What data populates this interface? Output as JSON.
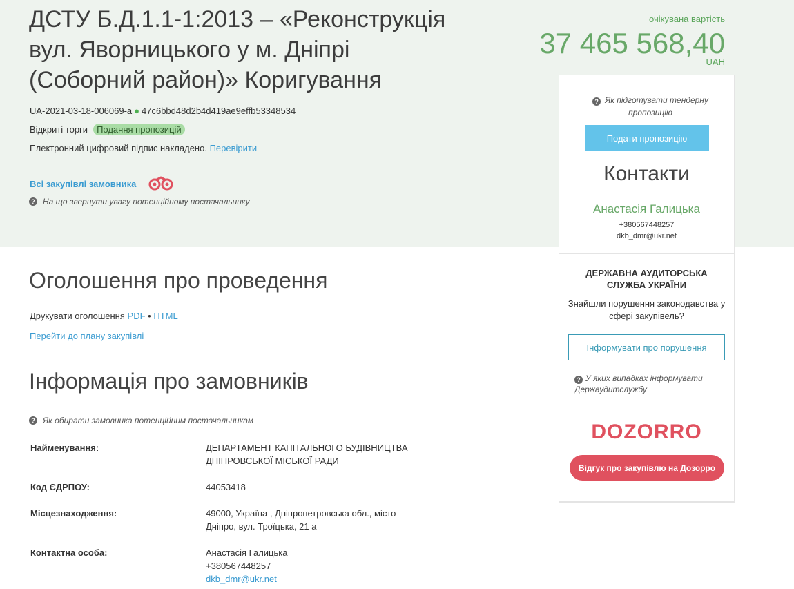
{
  "header": {
    "title": "ДСТУ Б.Д.1.1-1:2013 – «Реконструкція вул. Яворницького у м. Дніпрі (Соборний район)» Коригування",
    "tender_id": "UA-2021-03-18-006069-a",
    "tender_hash": "47c6bbd48d2b4d419ae9effb53348534",
    "procedure_type": "Відкриті торги",
    "status_badge": "Подання пропозицій",
    "signature_text": "Електронний цифровий підпис накладено.",
    "signature_link": "Перевірити",
    "all_purchases_link": "Всі закупівлі замовника",
    "supplier_hint": "На що звернути увагу потенційному постачальнику"
  },
  "expected_value": {
    "label": "очікувана вартість",
    "amount": "37 465 568,40",
    "currency": "UAH"
  },
  "sidebar": {
    "prepare_hint": "Як підготувати тендерну пропозицію",
    "propose_button": "Подати пропозицію",
    "contacts_title": "Контакти",
    "contact_name": "Анастасія Галицька",
    "contact_phone": "+380567448257",
    "contact_email": "dkb_dmr@ukr.net",
    "dasu_title": "ДЕРЖАВНА АУДИТОРСЬКА СЛУЖБА УКРАЇНИ",
    "dasu_text": "Знайшли порушення законодавства у сфері закупівель?",
    "inform_button": "Інформувати про порушення",
    "dasu_hint": "У яких випадках інформувати Держаудитслужбу",
    "dozorro_logo": "DOZORRO",
    "dozorro_button": "Відгук про закупівлю на Дозорро"
  },
  "announcement": {
    "heading": "Оголошення про проведення",
    "print_label": "Друкувати оголошення",
    "pdf_link": "PDF",
    "separator": "•",
    "html_link": "HTML",
    "plan_link": "Перейти до плану закупівлі"
  },
  "customers": {
    "heading": "Інформація про замовників",
    "hint": "Як обирати замовника потенційним постачальникам",
    "rows": [
      {
        "label": "Найменування:",
        "value": "ДЕПАРТАМЕНТ КАПІТАЛЬНОГО БУДІВНИЦТВА ДНІПРОВСЬКОЇ МІСЬКОЇ РАДИ"
      },
      {
        "label": "Код ЄДРПОУ:",
        "value": "44053418"
      },
      {
        "label": "Місцезнаходження:",
        "value": "49000, Україна , Дніпропетровська обл., місто Дніпро, вул. Троїцька, 21 а"
      },
      {
        "label": "Контактна особа:",
        "name": "Анастасія Галицька",
        "phone": "+380567448257",
        "email": "dkb_dmr@ukr.net"
      }
    ]
  },
  "colors": {
    "accent_green": "#68a868",
    "link_blue": "#3a9bd1",
    "button_blue": "#63c3ea",
    "dozorro_red": "#e0515f",
    "top_band_bg": "#eef3ee"
  }
}
